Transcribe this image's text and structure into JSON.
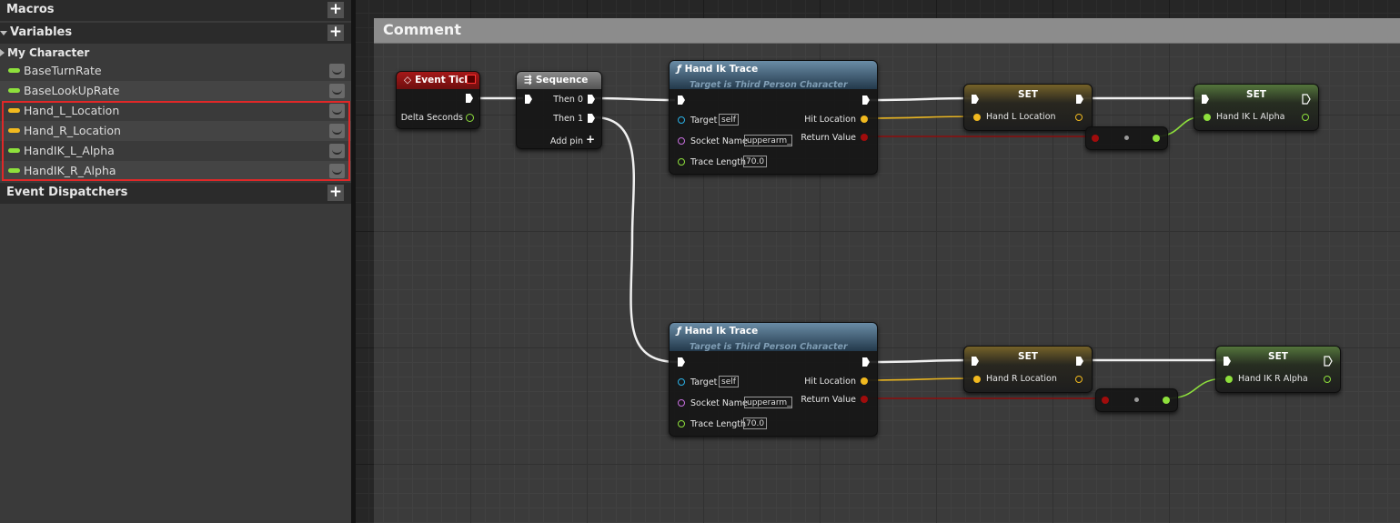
{
  "panel": {
    "macros_label": "Macros",
    "variables_label": "Variables",
    "my_character_label": "My Character",
    "event_dispatchers_label": "Event Dispatchers",
    "variables": [
      {
        "name": "BaseTurnRate",
        "type_color": "#9cef4a"
      },
      {
        "name": "BaseLookUpRate",
        "type_color": "#9cef4a"
      },
      {
        "name": "Hand_L_Location",
        "type_color": "#f6c22a"
      },
      {
        "name": "Hand_R_Location",
        "type_color": "#f6c22a"
      },
      {
        "name": "HandIK_L_Alpha",
        "type_color": "#9cef4a"
      },
      {
        "name": "HandIK_R_Alpha",
        "type_color": "#9cef4a"
      }
    ]
  },
  "graph": {
    "comment_title": "Comment",
    "event_tick": {
      "title": "Event Tick",
      "delta_label": "Delta Seconds"
    },
    "sequence": {
      "title": "Sequence",
      "then0": "Then 0",
      "then1": "Then 1",
      "add_pin": "Add pin"
    },
    "trace_top": {
      "title": "Hand Ik Trace",
      "subtitle": "Target is Third Person Character",
      "target_label": "Target",
      "target_value": "self",
      "socket_label": "Socket Name",
      "socket_value": "upperarm_l",
      "trace_label": "Trace Length",
      "trace_value": "70.0",
      "hit_label": "Hit Location",
      "return_label": "Return Value"
    },
    "trace_bottom": {
      "title": "Hand Ik Trace",
      "subtitle": "Target is Third Person Character",
      "target_label": "Target",
      "target_value": "self",
      "socket_label": "Socket Name",
      "socket_value": "upperarm_r",
      "trace_label": "Trace Length",
      "trace_value": "70.0",
      "hit_label": "Hit Location",
      "return_label": "Return Value"
    },
    "set_l_location": {
      "title": "SET",
      "pin_label": "Hand L Location"
    },
    "set_l_alpha": {
      "title": "SET",
      "pin_label": "Hand IK L Alpha"
    },
    "set_r_location": {
      "title": "SET",
      "pin_label": "Hand R Location"
    },
    "set_r_alpha": {
      "title": "SET",
      "pin_label": "Hand IK R Alpha"
    },
    "colors": {
      "exec": "#ffffff",
      "vector": "#f6c22a",
      "bool": "#a00c0c",
      "float": "#9cef4a",
      "object": "#2bb1e6",
      "name": "#c870e0"
    }
  }
}
